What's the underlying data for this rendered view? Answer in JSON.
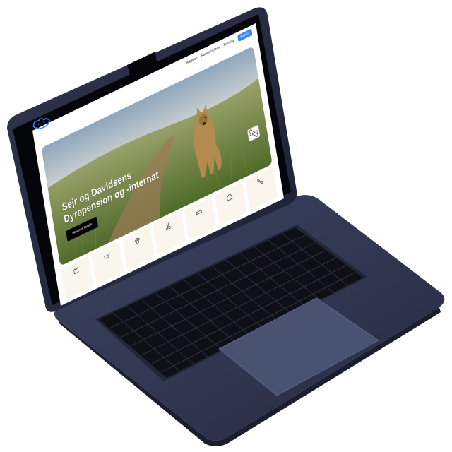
{
  "nav": {
    "links": [
      "Adoption",
      "Pensionsplads",
      "Træning"
    ],
    "signin": "Sign in"
  },
  "hero": {
    "title_line1": "Sejr og Davidsens",
    "title_line2": "Dyrepension og -internat",
    "button": "Se vores hunde"
  },
  "cards": {
    "icons": [
      "house-icon",
      "scissors-icon",
      "bone-icon",
      "bed-icon",
      "bowl-icon",
      "dog-icon",
      "paw-icon"
    ]
  },
  "colors": {
    "laptop_body": "#2f3550",
    "keys": "#0d0e12",
    "accent": "#3b82f6",
    "hero_button": "#000000"
  }
}
